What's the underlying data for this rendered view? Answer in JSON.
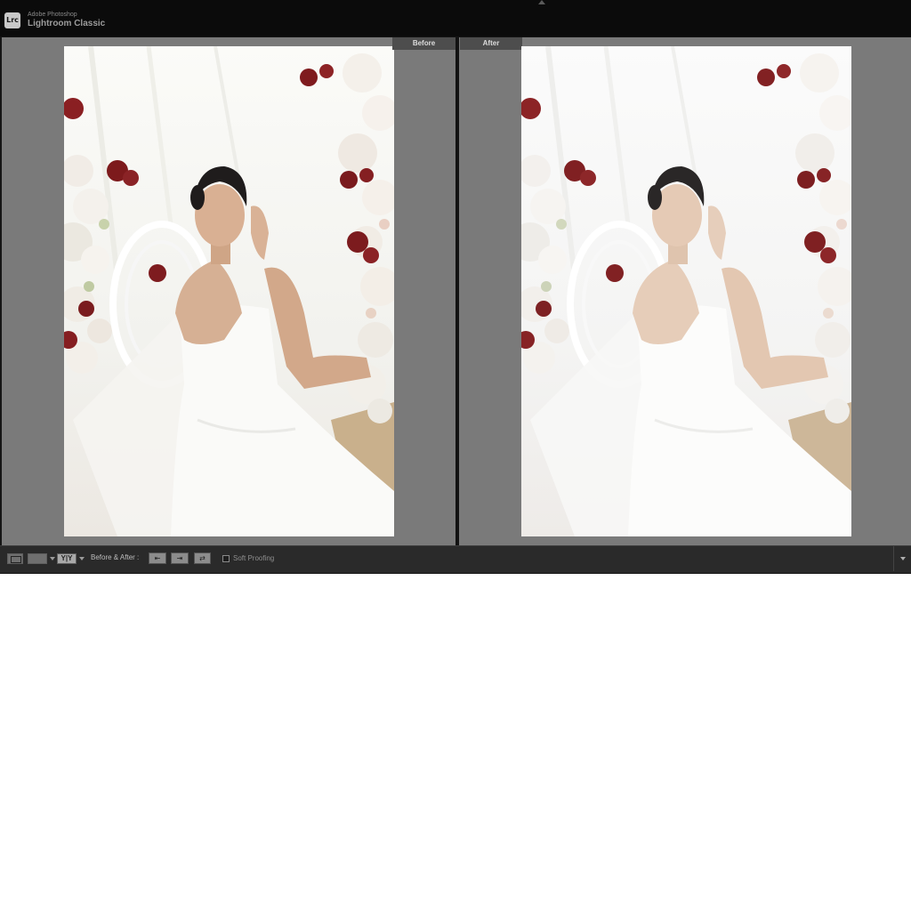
{
  "app": {
    "logo_text": "Lrc",
    "brand_line1": "Adobe Photoshop",
    "brand_line2": "Lightroom Classic"
  },
  "views": {
    "before_label": "Before",
    "after_label": "After"
  },
  "toolbar": {
    "yy_label": "Y|Y",
    "before_after_label": "Before & After :",
    "soft_proofing_label": "Soft Proofing",
    "soft_proofing_checked": false
  },
  "icons": {
    "loupe": "loupe-view-icon",
    "compare": "compare-view-icon",
    "before_after": "before-after-view-icon",
    "copy_before_to_after": "copy-settings-icon",
    "copy_after_to_before": "copy-settings-reverse-icon",
    "swap": "swap-icon"
  },
  "colors": {
    "panel_bg": "#7a7a7a",
    "toolbar_bg": "#2a2a2a",
    "titlebar_bg": "#0b0b0b"
  }
}
